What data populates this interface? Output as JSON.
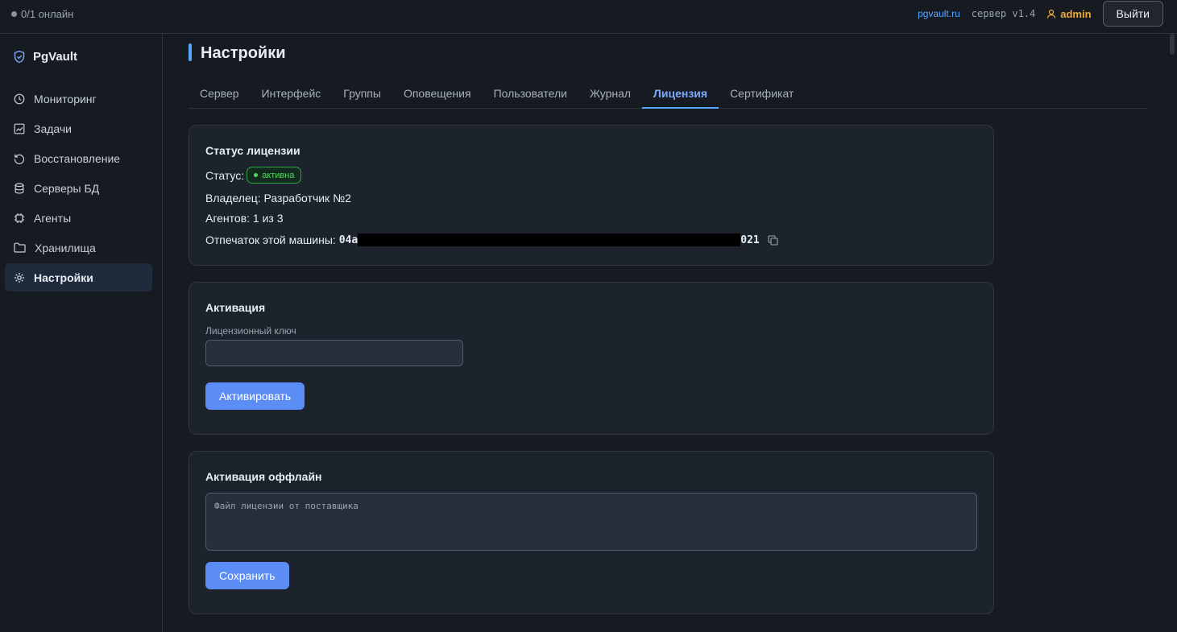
{
  "topbar": {
    "online": "0/1 онлайн",
    "link": "pgvault.ru",
    "version": "сервер v1.4",
    "user": "admin",
    "logout": "Выйти"
  },
  "sidebar": {
    "brand": "PgVault",
    "items": [
      {
        "label": "Мониторинг",
        "icon": "clock-icon"
      },
      {
        "label": "Задачи",
        "icon": "chart-icon"
      },
      {
        "label": "Восстановление",
        "icon": "restore-icon"
      },
      {
        "label": "Серверы БД",
        "icon": "database-icon"
      },
      {
        "label": "Агенты",
        "icon": "chip-icon"
      },
      {
        "label": "Хранилища",
        "icon": "folder-icon"
      },
      {
        "label": "Настройки",
        "icon": "gear-icon",
        "active": true
      }
    ]
  },
  "page": {
    "title": "Настройки",
    "tabs": [
      "Сервер",
      "Интерфейс",
      "Группы",
      "Оповещения",
      "Пользователи",
      "Журнал",
      "Лицензия",
      "Сертификат"
    ],
    "active_tab": "Лицензия"
  },
  "license_status": {
    "title": "Статус лицензии",
    "status_label": "Статус:",
    "status_value": "активна",
    "owner": "Владелец: Разработчик №2",
    "agents": "Агентов: 1 из 3",
    "fingerprint_label": "Отпечаток этой машины:",
    "fingerprint_start": "04a",
    "fingerprint_end": "021"
  },
  "activation": {
    "title": "Активация",
    "key_label": "Лицензионный ключ",
    "key_value": "",
    "button": "Активировать"
  },
  "offline": {
    "title": "Активация оффлайн",
    "placeholder": "Файл лицензии от поставщика",
    "button": "Сохранить"
  },
  "colors": {
    "accent": "#58a6ff",
    "button": "#5b8df5",
    "success": "#56d364",
    "user": "#f0a93b"
  }
}
